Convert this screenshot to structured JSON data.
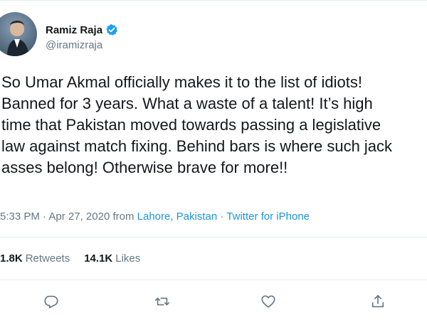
{
  "user": {
    "display_name": "Ramiz Raja",
    "handle": "@iramizraja",
    "verified": true
  },
  "tweet": {
    "text": "So Umar Akmal officially makes it to the list of idiots!\nBanned for 3 years. What a waste of a talent! It’s high\ntime that Pakistan moved towards passing a legislative\nlaw against match fixing. Behind bars is where such jack\nasses belong! Otherwise brave for more!!"
  },
  "meta": {
    "time": "5:33 PM",
    "sep1": " · ",
    "date": "Apr 27, 2020",
    "from": " from ",
    "location": "Lahore, Pakistan",
    "sep2": " · ",
    "source": "Twitter for iPhone"
  },
  "stats": {
    "retweets_count": "1.8K",
    "retweets_label": "Retweets",
    "likes_count": "14.1K",
    "likes_label": "Likes"
  },
  "colors": {
    "link": "#1b95e0",
    "secondary_text": "#657786",
    "verified": "#1da1f2"
  },
  "icons": {
    "reply": "reply-icon",
    "retweet": "retweet-icon",
    "like": "like-icon",
    "share": "share-icon",
    "verified": "verified-badge-icon"
  }
}
